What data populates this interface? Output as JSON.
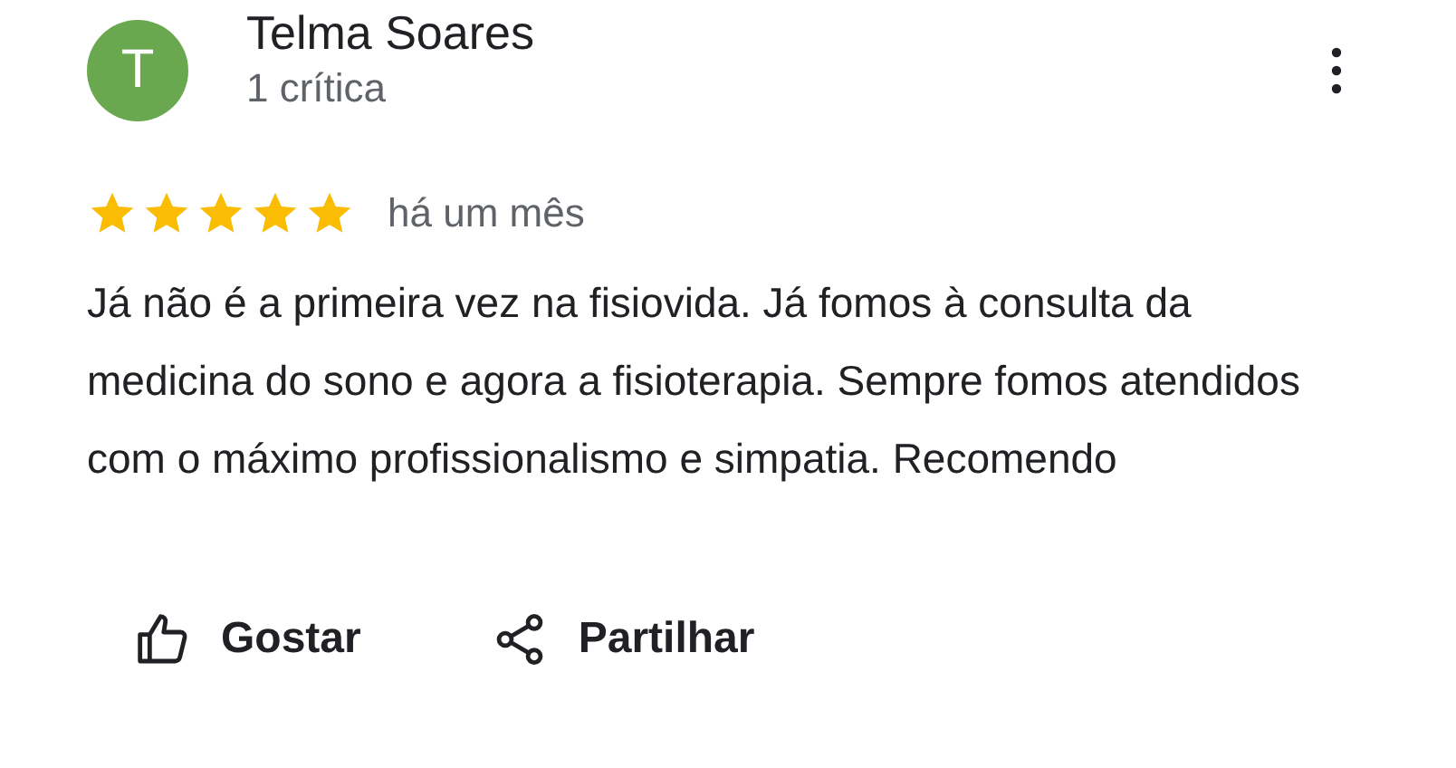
{
  "review": {
    "avatar_letter": "T",
    "author": "Telma Soares",
    "reviews_count": "1 crítica",
    "stars": 5,
    "time": "há um mês",
    "text": "Já não é a primeira vez na fisiovida. Já fomos à consulta da medicina do sono e agora a fisioterapia. Sempre fomos atendidos com o máximo profissionalismo e simpatia. Recomendo",
    "actions": [
      {
        "kind": "like",
        "label": "Gostar"
      },
      {
        "kind": "share",
        "label": "Partilhar"
      }
    ]
  }
}
